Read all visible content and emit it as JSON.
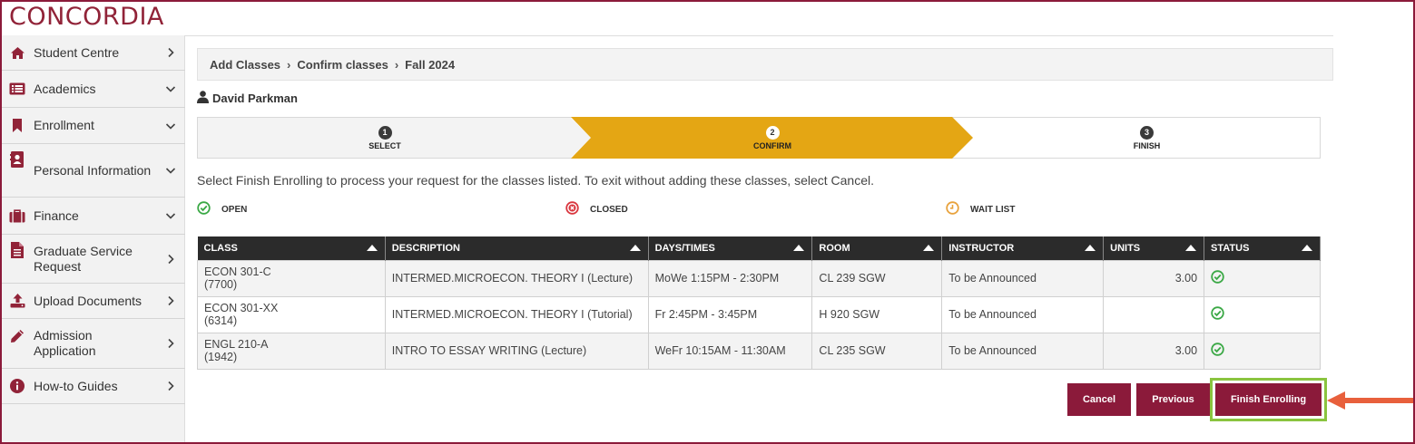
{
  "brand": {
    "logo_text": "CONCORDIA",
    "accent": "#912338",
    "button_color": "#8b1a3a",
    "highlight_color": "#8ac43f",
    "arrow_color": "#e8603c",
    "step_active_color": "#e4a614"
  },
  "sidebar": {
    "items": [
      {
        "label": "Student Centre",
        "icon": "home-icon",
        "chevron": "right"
      },
      {
        "label": "Academics",
        "icon": "list-icon",
        "chevron": "down"
      },
      {
        "label": "Enrollment",
        "icon": "bookmark-icon",
        "chevron": "down"
      },
      {
        "label": "Personal Information",
        "icon": "contact-card-icon",
        "chevron": "down"
      },
      {
        "label": "Finance",
        "icon": "briefcase-icon",
        "chevron": "down"
      },
      {
        "label": "Graduate Service Request",
        "icon": "document-icon",
        "chevron": "right"
      },
      {
        "label": "Upload Documents",
        "icon": "upload-icon",
        "chevron": "right"
      },
      {
        "label": "Admission Application",
        "icon": "pencil-icon",
        "chevron": "right"
      },
      {
        "label": "How-to Guides",
        "icon": "info-icon",
        "chevron": "right"
      }
    ]
  },
  "breadcrumb": {
    "items": [
      "Add Classes",
      "Confirm classes",
      "Fall 2024"
    ]
  },
  "user": {
    "name": "David Parkman",
    "icon": "user-icon"
  },
  "steps": [
    {
      "number": "1",
      "label": "SELECT",
      "state": "done"
    },
    {
      "number": "2",
      "label": "CONFIRM",
      "state": "active"
    },
    {
      "number": "3",
      "label": "FINISH",
      "state": "pending"
    }
  ],
  "instructions": "Select Finish Enrolling to process your request for the classes listed.  To exit without adding these classes, select Cancel.",
  "legend": [
    {
      "label": "OPEN",
      "icon": "open-check-icon",
      "color": "#3aa845"
    },
    {
      "label": "CLOSED",
      "icon": "closed-x-icon",
      "color": "#d9363e"
    },
    {
      "label": "WAIT LIST",
      "icon": "waitlist-clock-icon",
      "color": "#e8a23c"
    }
  ],
  "table": {
    "headers": [
      "CLASS",
      "DESCRIPTION",
      "DAYS/TIMES",
      "ROOM",
      "INSTRUCTOR",
      "UNITS",
      "STATUS"
    ],
    "rows": [
      {
        "class_code": "ECON 301-C",
        "class_number": "(7700)",
        "description": "INTERMED.MICROECON. THEORY I (Lecture)",
        "days_times": "MoWe 1:15PM - 2:30PM",
        "room": "CL 239 SGW",
        "instructor": "To be Announced",
        "units": "3.00",
        "status": "open"
      },
      {
        "class_code": "ECON 301-XX",
        "class_number": "(6314)",
        "description": "INTERMED.MICROECON. THEORY I (Tutorial)",
        "days_times": "Fr 2:45PM - 3:45PM",
        "room": "H 920 SGW",
        "instructor": "To be Announced",
        "units": "",
        "status": "open"
      },
      {
        "class_code": "ENGL 210-A",
        "class_number": "(1942)",
        "description": "INTRO TO ESSAY WRITING (Lecture)",
        "days_times": "WeFr 10:15AM - 11:30AM",
        "room": "CL 235 SGW",
        "instructor": "To be Announced",
        "units": "3.00",
        "status": "open"
      }
    ]
  },
  "buttons": {
    "cancel": "Cancel",
    "previous": "Previous",
    "finish": "Finish Enrolling"
  }
}
